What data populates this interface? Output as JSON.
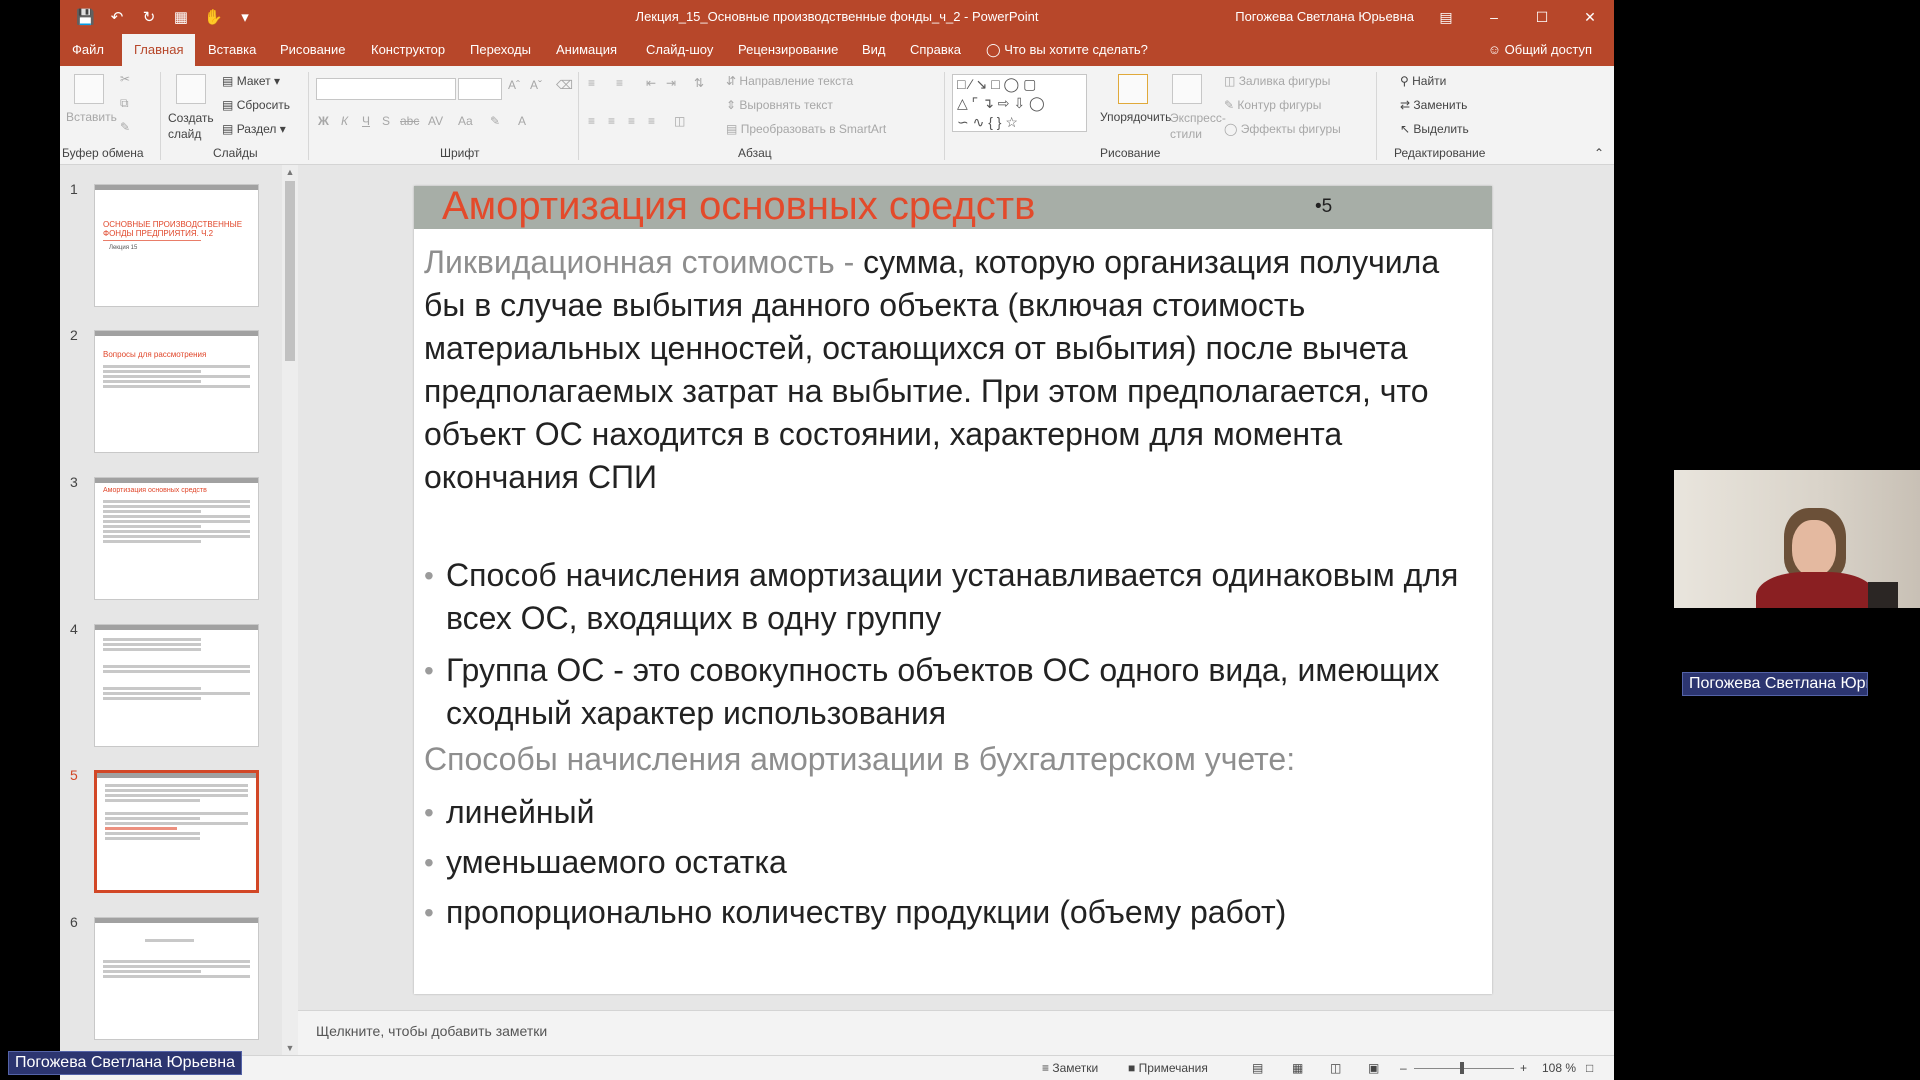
{
  "window": {
    "title": "Лекция_15_Основные производственные фонды_ч_2  -  PowerPoint",
    "user": "Погожева Светлана Юрьевна"
  },
  "tabs": [
    "Файл",
    "Главная",
    "Вставка",
    "Рисование",
    "Конструктор",
    "Переходы",
    "Анимация",
    "Слайд-шоу",
    "Рецензирование",
    "Вид",
    "Справка"
  ],
  "tell_me": "Что вы хотите сделать?",
  "share": "Общий доступ",
  "ribbon": {
    "paste": "Вставить",
    "create_slide": "Создать слайд",
    "layout": "Макет",
    "reset": "Сбросить",
    "section": "Раздел",
    "text_direction": "Направление текста",
    "align_text": "Выровнять текст",
    "smartart": "Преобразовать в SmartArt",
    "arrange": "Упорядочить",
    "quick_styles": "Экспресс-стили",
    "shape_fill": "Заливка фигуры",
    "shape_outline": "Контур фигуры",
    "shape_effects": "Эффекты фигуры",
    "find": "Найти",
    "replace": "Заменить",
    "select": "Выделить",
    "groups": {
      "clipboard": "Буфер обмена",
      "slides": "Слайды",
      "font": "Шрифт",
      "paragraph": "Абзац",
      "drawing": "Рисование",
      "editing": "Редактирование"
    }
  },
  "thumbnails": {
    "numbers": [
      "1",
      "2",
      "3",
      "4",
      "5",
      "6"
    ],
    "t1_title": "ОСНОВНЫЕ ПРОИЗВОДСТВЕННЫЕ ФОНДЫ ПРЕДПРИЯТИЯ. Ч.2",
    "t1_sub": "Лекция 15",
    "t2_title": "Вопросы для рассмотрения",
    "t3_title": "Амортизация основных средств"
  },
  "slide": {
    "title": "Амортизация основных средств",
    "number": "•5",
    "term": "Ликвидационная стоимость - ",
    "definition": "сумма, которую организация получила бы в случае выбытия данного объекта (включая стоимость материальных ценностей, остающихся от выбытия) после вычета предполагаемых затрат на выбытие. При этом предполагается, что объект ОС находится в состоянии, характерном для момента окончания СПИ",
    "bullets": [
      "Способ начисления амортизации устанавливается одинаковым для всех ОС, входящих в одну группу",
      "Группа ОС - это совокупность объектов ОС одного вида, имеющих сходный характер использования"
    ],
    "methods_heading": "Способы начисления амортизации в бухгалтерском учете:",
    "methods": [
      "линейный",
      "уменьшаемого остатка",
      "пропорционально количеству продукции (объему работ)"
    ]
  },
  "notes_placeholder": "Щелкните, чтобы добавить заметки",
  "status": {
    "notes": "Заметки",
    "comments": "Примечания",
    "zoom": "108 %"
  },
  "video": {
    "participant_right": "Погожева Светлана Юрь...",
    "participant_left": "Погожева Светлана Юрьевна"
  },
  "colors": {
    "accent": "#b7472a",
    "title_red": "#e34a2b"
  }
}
